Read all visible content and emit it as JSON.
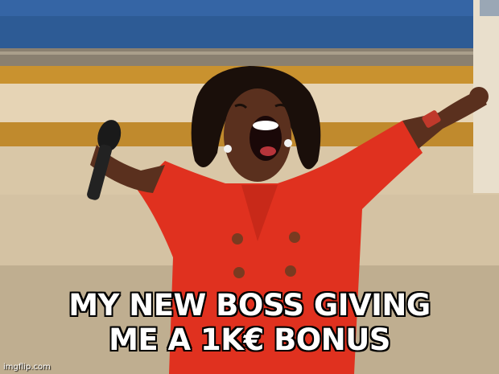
{
  "caption": {
    "line1": "MY NEW BOSS GIVING",
    "line2": "ME A 1K€ BONUS"
  },
  "watermark": "imgflip.com",
  "colors": {
    "dress": "#e0311f",
    "background_wall": "#d8c9b0",
    "screen": "#2d5b95",
    "skin": "#5a301e",
    "hair": "#1a0f0a"
  }
}
